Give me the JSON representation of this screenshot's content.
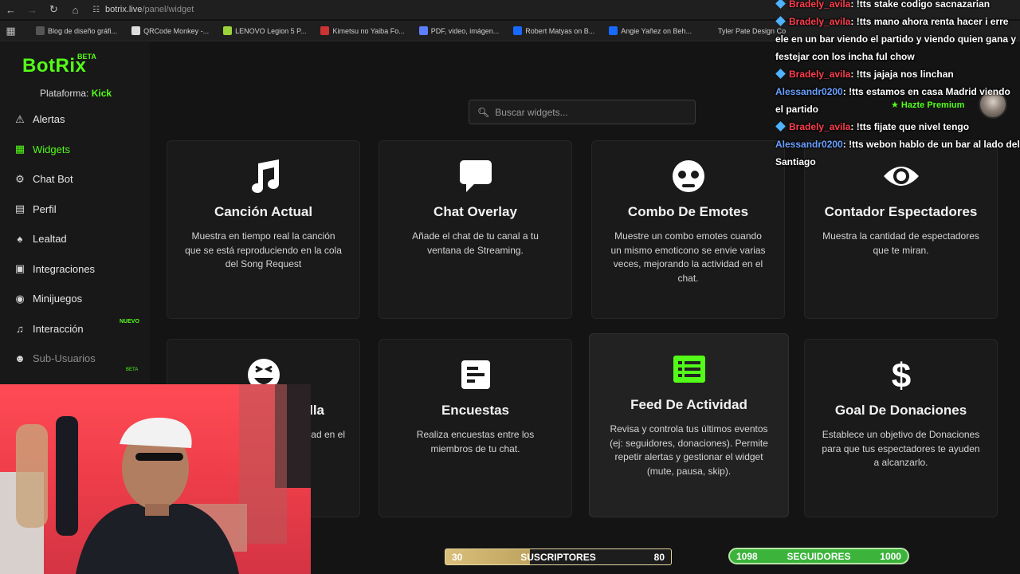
{
  "browser": {
    "url_host": "botrix.live",
    "url_path": "/panel/widget",
    "bookmarks": [
      {
        "label": "Blog de diseño gráfi...",
        "color": "#555"
      },
      {
        "label": "QRCode Monkey -...",
        "color": "#ddd"
      },
      {
        "label": "LENOVO Legion 5 P...",
        "color": "#9ad33a"
      },
      {
        "label": "Kimetsu no Yaiba Fo...",
        "color": "#c33"
      },
      {
        "label": "PDF, video, imágen...",
        "color": "#5b7fff"
      },
      {
        "label": "Robert Matyas on B...",
        "color": "#1769ff"
      },
      {
        "label": "Angie Yañez on Beh...",
        "color": "#1769ff"
      },
      {
        "label": "Tyler Pate Design Co",
        "color": "#1f1f1f"
      }
    ]
  },
  "app": {
    "logo": "BotRix",
    "logo_badge": "BETA",
    "platform_label": "Plataforma:",
    "platform_value": "Kick"
  },
  "sidebar": {
    "items": [
      {
        "label": "Alertas",
        "icon": "warning-icon"
      },
      {
        "label": "Widgets",
        "icon": "widgets-icon"
      },
      {
        "label": "Chat Bot",
        "icon": "robot-icon"
      },
      {
        "label": "Perfil",
        "icon": "id-card-icon"
      },
      {
        "label": "Lealtad",
        "icon": "trophy-icon"
      },
      {
        "label": "Integraciones",
        "icon": "integrations-icon"
      },
      {
        "label": "Minijuegos",
        "icon": "gamepad-icon"
      },
      {
        "label": "Interacción",
        "icon": "music-note-icon",
        "tag": "NUEVO"
      },
      {
        "label": "Sub-Usuarios",
        "icon": "users-icon",
        "tag": "BETA"
      }
    ]
  },
  "search": {
    "placeholder": "Buscar widgets..."
  },
  "widgets": [
    {
      "title": "Canción Actual",
      "desc": "Muestra en tiempo real la canción que se está reproduciendo en la cola del Song Request",
      "icon": "music-icon"
    },
    {
      "title": "Chat Overlay",
      "desc": "Añade el chat de tu canal a tu ventana de Streaming.",
      "icon": "chat-icon"
    },
    {
      "title": "Combo De Emotes",
      "desc": "Muestre un combo emotes cuando un mismo emoticono se envie varias veces, mejorando la actividad en el chat.",
      "icon": "emote-icon"
    },
    {
      "title": "Contador Espectadores",
      "desc": "Muestra la cantidad de espectadores que te miran.",
      "icon": "eye-icon"
    },
    {
      "title": "lla",
      "desc": "envian ad en el",
      "icon": "laugh-icon"
    },
    {
      "title": "Encuestas",
      "desc": "Realiza encuestas entre los miembros de tu chat.",
      "icon": "poll-icon"
    },
    {
      "title": "Feed De Actividad",
      "desc": "Revisa y controla tus últimos eventos (ej: seguidores, donaciones). Permite repetir alertas y gestionar el widget (mute, pausa, skip).",
      "icon": "list-icon"
    },
    {
      "title": "Goal De Donaciones",
      "desc": "Establece un objetivo de Donaciones para que tus espectadores te ayuden a alcanzarlo.",
      "icon": "dollar-icon"
    }
  ],
  "chat_overlay": {
    "messages": [
      {
        "user": "Bradely_avila",
        "user_color": "#ff3e4d",
        "badge": true,
        "text": ": !tts stake codigo sacnazarian"
      },
      {
        "user": "Bradely_avila",
        "user_color": "#ff3e4d",
        "badge": true,
        "text": ": !tts mano ahora renta hacer i erre ele en un bar viendo el partido y viendo quien gana y festejar con los incha ful chow"
      },
      {
        "user": "Bradely_avila",
        "user_color": "#ff3e4d",
        "badge": true,
        "text": ": !tts jajaja nos linchan"
      },
      {
        "user": "Alessandr0200",
        "user_color": "#6aa0ff",
        "badge": false,
        "text": ": !tts estamos en casa Madrid viendo el partido"
      },
      {
        "user": "Bradely_avila",
        "user_color": "#ff3e4d",
        "badge": true,
        "text": ": !tts fijate que nivel tengo"
      },
      {
        "user": "Alessandr0200",
        "user_color": "#6aa0ff",
        "badge": false,
        "text": ": !tts webon hablo de un bar al lado del Santiago"
      }
    ],
    "premium_label": "Hazte Premium"
  },
  "stream_stats": {
    "subs": {
      "label": "SUSCRIPTORES",
      "current": "30",
      "goal": "80",
      "progress": 0.375
    },
    "follows": {
      "label": "SEGUIDORES",
      "current": "1098",
      "goal": "1000",
      "progress": 1.0
    }
  },
  "colors": {
    "accent": "#53fc18",
    "card_bg": "#1a1a1a",
    "page_bg": "#141414"
  }
}
